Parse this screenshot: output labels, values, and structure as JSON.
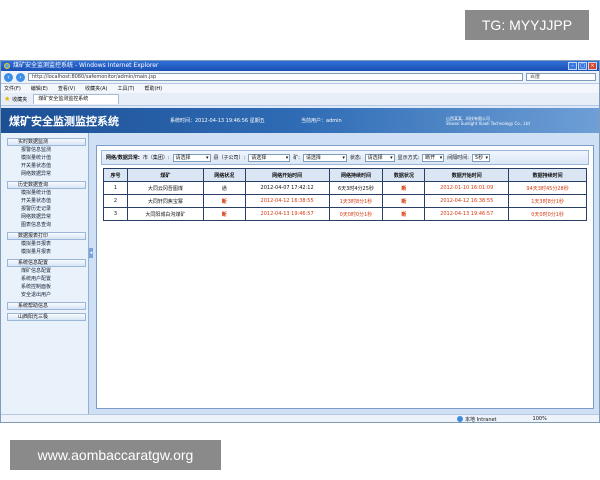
{
  "watermarks": {
    "top": "TG: MYYJJPP",
    "bottom": "www.aombaccaratgw.org"
  },
  "browser": {
    "title": "煤矿安全监测监控系统 - Windows Internet Explorer",
    "address": "http://localhost:8080/safemonitor/admin/main.jsp",
    "search_placeholder": "百度",
    "menu": [
      "文件(F)",
      "编辑(E)",
      "查看(V)",
      "收藏夹(A)",
      "工具(T)",
      "帮助(H)"
    ],
    "favorites_label": "收藏夹",
    "tab_label": "煤矿安全监测监控系统",
    "status_zone": "本地 Intranet",
    "status_zoom": "100%"
  },
  "app": {
    "title": "煤矿安全监测监控系统",
    "system_time": "系统时间：2012-04-13 19:46:56 星期五",
    "current_user": "当前用户：admin",
    "company_cn": "山西某某…科技有限公司",
    "company_en": "Shanxi Sunlight Xiaoli Technology Co., Ltd"
  },
  "sidebar": {
    "groups": [
      {
        "title": "实时数据监测",
        "items": [
          "报警信息监测",
          "模拟量统计值",
          "开关量状态值",
          "网络数据异常"
        ]
      },
      {
        "title": "历史数据查询",
        "items": [
          "模拟量统计值",
          "开关量状态值",
          "报警历史记录",
          "网络数据异常",
          "图表信息查询"
        ]
      },
      {
        "title": "数据报表打印",
        "items": [
          "模拟量日报表",
          "模拟量月报表"
        ]
      },
      {
        "title": "系统信息配置",
        "items": [
          "煤矿信息配置",
          "系统用户配置",
          "系统控制面板",
          "安全退出用户"
        ]
      },
      {
        "title": "系统帮助信息",
        "items": []
      },
      {
        "title": "山西阳光三极",
        "items": []
      }
    ]
  },
  "filter": {
    "label": "网络/数据异常:",
    "city_label": "市（集团）:",
    "city_value": "请选择",
    "county_label": "县（子公司）:",
    "county_value": "请选择",
    "mine_label": "矿:",
    "mine_value": "请选择",
    "status_label": "状态:",
    "status_value": "请选择",
    "display_label": "显示方式:",
    "display_value": "断开",
    "interval_label": "间隔时间:",
    "interval_value": "5秒"
  },
  "table": {
    "headers": [
      "序号",
      "煤矿",
      "网络状况",
      "网络开始时间",
      "网络持续时间",
      "数据状况",
      "数据开始时间",
      "数据持续时间"
    ],
    "rows": [
      {
        "no": "1",
        "mine": "大同云冈吾图煤",
        "net_status": "通",
        "net_start": "2012-04-07 17:42:12",
        "net_duration": "6天3时4分25秒",
        "data_status": "断",
        "data_start": "2012-01-10 16:01:09",
        "data_duration": "94天3时45分28秒"
      },
      {
        "no": "2",
        "mine": "大同轩同焦宝寨",
        "net_status": "断",
        "net_start": "2012-04-12 16:38:55",
        "net_duration": "1天3时8分1秒",
        "data_status": "断",
        "data_start": "2012-04-12 16:38:55",
        "data_duration": "1天3时8分1秒"
      },
      {
        "no": "3",
        "mine": "大同阳城白沟煤矿",
        "net_status": "断",
        "net_start": "2012-04-13 19:46:57",
        "net_duration": "0天0时0分1秒",
        "data_status": "断",
        "data_start": "2012-04-13 19:46:57",
        "data_duration": "0天0时0分1秒"
      }
    ]
  }
}
